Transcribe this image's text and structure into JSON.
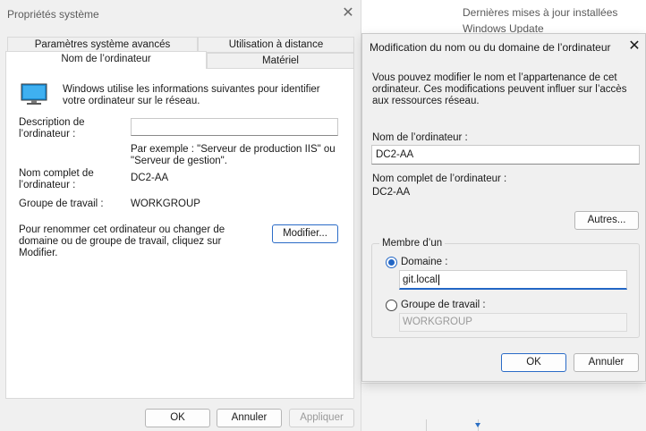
{
  "background": {
    "updates_text": "Dernières mises à jour installées",
    "windows_update": "Windows Update"
  },
  "sysprops": {
    "title": "Propriétés système",
    "tabs": {
      "advanced": "Paramètres système avancés",
      "remote": "Utilisation à distance",
      "computer_name": "Nom de l’ordinateur",
      "hardware": "Matériel"
    },
    "intro": "Windows utilise les informations suivantes pour identifier votre ordinateur sur le réseau.",
    "description_label": "Description de l’ordinateur :",
    "description_value": "",
    "example": "Par exemple : \"Serveur de production IIS\" ou \"Serveur de gestion\".",
    "full_name_label": "Nom complet de l’ordinateur :",
    "full_name_value": "DC2-AA",
    "workgroup_label": "Groupe de travail :",
    "workgroup_value": "WORKGROUP",
    "rename_text": "Pour renommer cet ordinateur ou changer de domaine ou de groupe de travail, cliquez sur Modifier.",
    "modify_button": "Modifier...",
    "ok_button": "OK",
    "cancel_button": "Annuler",
    "apply_button": "Appliquer"
  },
  "modify_dialog": {
    "title": "Modification du nom ou du domaine de l’ordinateur",
    "intro": "Vous pouvez modifier le nom et l’appartenance de cet ordinateur. Ces modifications peuvent influer sur l’accès aux ressources réseau.",
    "computer_name_label": "Nom de l’ordinateur :",
    "computer_name_value": "DC2-AA",
    "full_name_label": "Nom complet de l’ordinateur :",
    "full_name_value": "DC2-AA",
    "more_button": "Autres...",
    "member_of_legend": "Membre d’un",
    "domain_label": "Domaine :",
    "domain_value": "git.local",
    "workgroup_label": "Groupe de travail :",
    "workgroup_value": "WORKGROUP",
    "ok_button": "OK",
    "cancel_button": "Annuler"
  }
}
